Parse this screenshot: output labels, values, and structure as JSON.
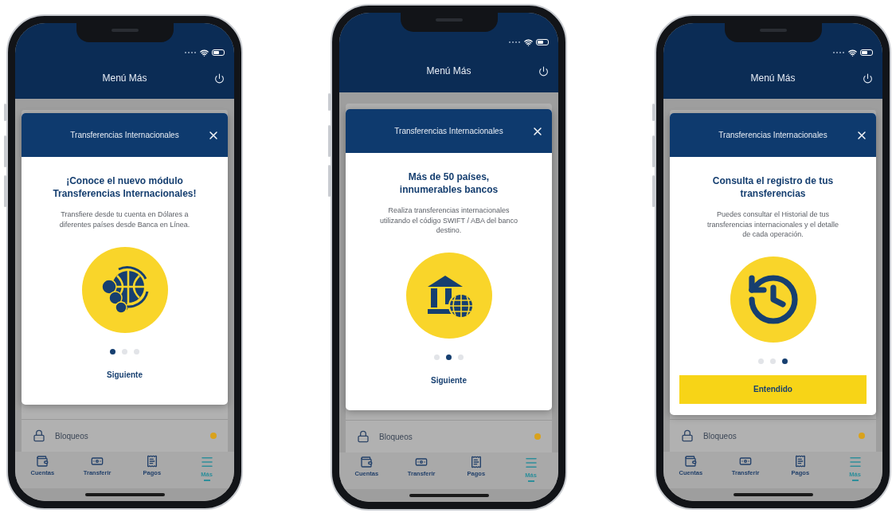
{
  "phones": [
    {
      "header": {
        "title": "Menú Más"
      },
      "menu_items": [
        {
          "kind": "lock",
          "label": "Bloqueos"
        }
      ],
      "modal": {
        "title": "Transferencias Internacionales",
        "heading": [
          "¡Conoce el nuevo módulo",
          "Transferencias Internacionales!"
        ],
        "text": [
          "Transfiere desde tu cuenta en Dólares a",
          "diferentes países desde Banca en Línea."
        ],
        "kind": "globe-coins",
        "pages": [
          {
            "selected": true
          },
          {
            "selected": false
          },
          {
            "selected": false
          }
        ],
        "action": {
          "kind": "link",
          "label": "Siguiente"
        }
      },
      "tabs": [
        {
          "kind": "wallet",
          "label": "Cuentas",
          "selected": false
        },
        {
          "kind": "transfer",
          "label": "Transferir",
          "selected": false
        },
        {
          "kind": "pay",
          "label": "Pagos",
          "selected": false
        },
        {
          "kind": "menu",
          "label": "Más",
          "selected": true
        }
      ]
    },
    {
      "header": {
        "title": "Menú Más"
      },
      "menu_items": [
        {
          "kind": "lock",
          "label": "Bloqueos"
        }
      ],
      "modal": {
        "title": "Transferencias Internacionales",
        "heading": [
          "Más de 50 países,",
          "innumerables bancos"
        ],
        "text": [
          "Realiza transferencias internacionales",
          "utilizando el código SWIFT / ABA del banco",
          "destino."
        ],
        "kind": "bank-globe",
        "pages": [
          {
            "selected": false
          },
          {
            "selected": true
          },
          {
            "selected": false
          }
        ],
        "action": {
          "kind": "link",
          "label": "Siguiente"
        }
      },
      "tabs": [
        {
          "kind": "wallet",
          "label": "Cuentas",
          "selected": false
        },
        {
          "kind": "transfer",
          "label": "Transferir",
          "selected": false
        },
        {
          "kind": "pay",
          "label": "Pagos",
          "selected": false
        },
        {
          "kind": "menu",
          "label": "Más",
          "selected": true
        }
      ]
    },
    {
      "header": {
        "title": "Menú Más"
      },
      "menu_items": [
        {
          "kind": "lock",
          "label": "Bloqueos"
        }
      ],
      "modal": {
        "title": "Transferencias Internacionales",
        "heading": [
          "Consulta el registro de tus",
          "transferencias"
        ],
        "text": [
          "Puedes consultar el Historial de tus",
          "transferencias internacionales y el detalle",
          "de cada operación."
        ],
        "kind": "history",
        "pages": [
          {
            "selected": false
          },
          {
            "selected": false
          },
          {
            "selected": true
          }
        ],
        "action": {
          "kind": "button",
          "label": "Entendido"
        }
      },
      "tabs": [
        {
          "kind": "wallet",
          "label": "Cuentas",
          "selected": false
        },
        {
          "kind": "transfer",
          "label": "Transferir",
          "selected": false
        },
        {
          "kind": "pay",
          "label": "Pagos",
          "selected": false
        },
        {
          "kind": "menu",
          "label": "Más",
          "selected": true
        }
      ]
    }
  ]
}
